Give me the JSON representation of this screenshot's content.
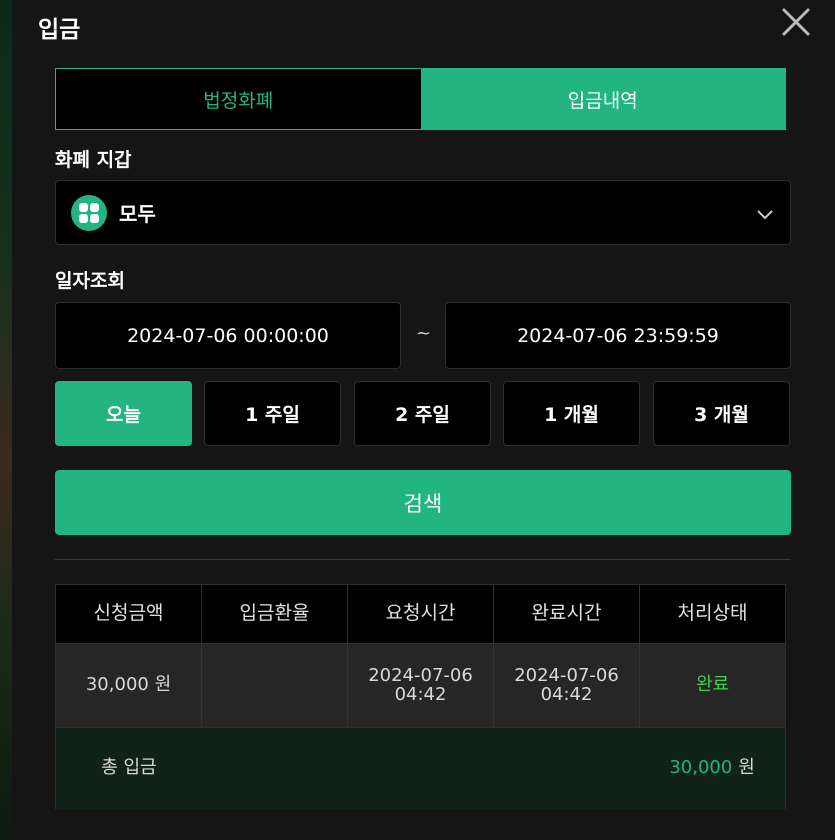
{
  "modal": {
    "title": "입금"
  },
  "tabs": [
    {
      "label": "법정화폐",
      "active": false
    },
    {
      "label": "입금내역",
      "active": true
    }
  ],
  "wallet": {
    "label": "화폐 지갑",
    "selected": "모두",
    "icon": "grid-icon"
  },
  "date_query": {
    "label": "일자조회",
    "start": "2024-07-06 00:00:00",
    "separator": "~",
    "end": "2024-07-06 23:59:59"
  },
  "periods": [
    {
      "label": "오늘",
      "active": true
    },
    {
      "label": "1 주일",
      "active": false
    },
    {
      "label": "2 주일",
      "active": false
    },
    {
      "label": "1 개월",
      "active": false
    },
    {
      "label": "3 개월",
      "active": false
    }
  ],
  "search_label": "검색",
  "table": {
    "headers": [
      "신청금액",
      "입금환율",
      "요청시간",
      "완료시간",
      "처리상태"
    ],
    "rows": [
      {
        "amount": "30,000 원",
        "rate": "",
        "request_date": "2024-07-06",
        "request_time": "04:42",
        "complete_date": "2024-07-06",
        "complete_time": "04:42",
        "status": "완료"
      }
    ],
    "total": {
      "label": "총 입금",
      "value": "30,000",
      "unit": "원"
    }
  },
  "colors": {
    "accent": "#22b582",
    "status_done": "#3fd24a",
    "background": "#151515"
  }
}
